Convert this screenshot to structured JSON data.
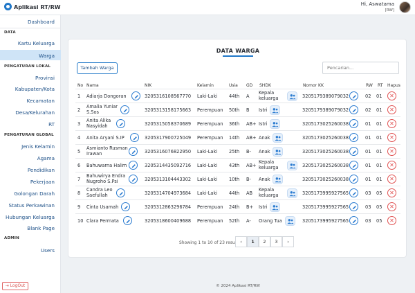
{
  "app": {
    "title": "Aplikasi RT/RW"
  },
  "user": {
    "greeting": "Hi, Aswatama",
    "role": "[RW]"
  },
  "sidebar": {
    "dashboard": "Dashboard",
    "section_data": "DATA",
    "kartu_keluarga": "Kartu Keluarga",
    "warga": "Warga",
    "section_lokal": "PENGATURAN LOKAL",
    "provinsi": "Provinsi",
    "kabupaten": "Kabupaten/Kota",
    "kecamatan": "Kecamatan",
    "desa": "Desa/Kelurahan",
    "rt": "RT",
    "section_global": "PENGATURAN GLOBAL",
    "jenis_kelamin": "Jenis Kelamin",
    "agama": "Agama",
    "pendidikan": "Pendidikan",
    "pekerjaan": "Pekerjaan",
    "golongan_darah": "Golongan Darah",
    "status_perkawinan": "Status Perkawinan",
    "hubungan_keluarga": "Hubungan Keluarga",
    "blank_page": "Blank Page",
    "section_admin": "ADMIN",
    "users": "Users",
    "logout": "LogOut"
  },
  "main": {
    "title": "DATA WARGA",
    "add_button": "Tambah Warga",
    "search_placeholder": "Pencarian...",
    "columns": {
      "no": "No",
      "nama": "Nama",
      "nik": "NIK",
      "kelamin": "Kelamin",
      "usia": "Usia",
      "gd": "GD",
      "shdk": "SHDK",
      "nomor_kk": "Nomor KK",
      "rw": "RW",
      "rt": "RT",
      "hapus": "Hapus"
    },
    "rows": [
      {
        "no": "1",
        "nama": [
          "Adiarja Dongoran"
        ],
        "nik": "3205316108567770",
        "kelamin": "Laki-Laki",
        "usia": "44th",
        "gd": "A",
        "shdk": [
          "Kepala",
          "keluarga"
        ],
        "kk": "3205179389079032",
        "rw": "02",
        "rt": "01"
      },
      {
        "no": "2",
        "nama": [
          "Amalia Yuniar",
          "S.Sos"
        ],
        "nik": "3205313158175663",
        "kelamin": "Perempuan",
        "usia": "50th",
        "gd": "B",
        "shdk": [
          "Istri"
        ],
        "kk": "3205179389079032",
        "rw": "02",
        "rt": "01"
      },
      {
        "no": "3",
        "nama": [
          "Anita Alika",
          "Nasyidah"
        ],
        "nik": "3205315058370689",
        "kelamin": "Perempuan",
        "usia": "36th",
        "gd": "AB+",
        "shdk": [
          "Istri"
        ],
        "kk": "3205173025260038",
        "rw": "01",
        "rt": "01"
      },
      {
        "no": "4",
        "nama": [
          "Anita Aryani S.IP"
        ],
        "nik": "3205317900725049",
        "kelamin": "Perempuan",
        "usia": "14th",
        "gd": "AB+",
        "shdk": [
          "Anak"
        ],
        "kk": "3205173025260038",
        "rw": "01",
        "rt": "01"
      },
      {
        "no": "5",
        "nama": [
          "Asmianto Rusman",
          "Irawan"
        ],
        "nik": "3205316076822950",
        "kelamin": "Laki-Laki",
        "usia": "25th",
        "gd": "B-",
        "shdk": [
          "Anak"
        ],
        "kk": "3205173025260038",
        "rw": "01",
        "rt": "01"
      },
      {
        "no": "6",
        "nama": [
          "Bahuwarna Halim"
        ],
        "nik": "3205314435092716",
        "kelamin": "Laki-Laki",
        "usia": "43th",
        "gd": "AB+",
        "shdk": [
          "Kepala",
          "keluarga"
        ],
        "kk": "3205173025260038",
        "rw": "01",
        "rt": "01"
      },
      {
        "no": "7",
        "nama": [
          "Bahuwirya Endra",
          "Nugroho S.Psi"
        ],
        "nik": "3205313104443302",
        "kelamin": "Laki-Laki",
        "usia": "10th",
        "gd": "B-",
        "shdk": [
          "Anak"
        ],
        "kk": "3205173025260038",
        "rw": "01",
        "rt": "01"
      },
      {
        "no": "8",
        "nama": [
          "Candra Leo",
          "Saefullah"
        ],
        "nik": "3205314704973684",
        "kelamin": "Laki-Laki",
        "usia": "44th",
        "gd": "AB",
        "shdk": [
          "Kepala",
          "keluarga"
        ],
        "kk": "3205173995927565",
        "rw": "03",
        "rt": "05"
      },
      {
        "no": "9",
        "nama": [
          "Cinta Usamah"
        ],
        "nik": "3205312863296784",
        "kelamin": "Perempuan",
        "usia": "24th",
        "gd": "B+",
        "shdk": [
          "Istri"
        ],
        "kk": "3205173995927565",
        "rw": "03",
        "rt": "05"
      },
      {
        "no": "10",
        "nama": [
          "Clara Permata"
        ],
        "nik": "3205318600409688",
        "kelamin": "Perempuan",
        "usia": "52th",
        "gd": "A-",
        "shdk": [
          "Orang Tua"
        ],
        "kk": "3205173995927565",
        "rw": "03",
        "rt": "05"
      }
    ],
    "pagination": {
      "info": "Showing 1 to 10 of 23 results",
      "prev": "‹",
      "pages": [
        "1",
        "2",
        "3"
      ],
      "next": "›",
      "active": "1"
    }
  },
  "footer": {
    "copyright": "© 2024 Aplikasi RT/RW"
  },
  "colors": {
    "accent": "#1f77c8",
    "active_bg": "#cfe4f7",
    "danger": "#e05050"
  },
  "icons": {
    "edit": "pencil-icon",
    "shdk": "people-icon",
    "delete": "x-circle-icon",
    "logout": "logout-icon"
  }
}
